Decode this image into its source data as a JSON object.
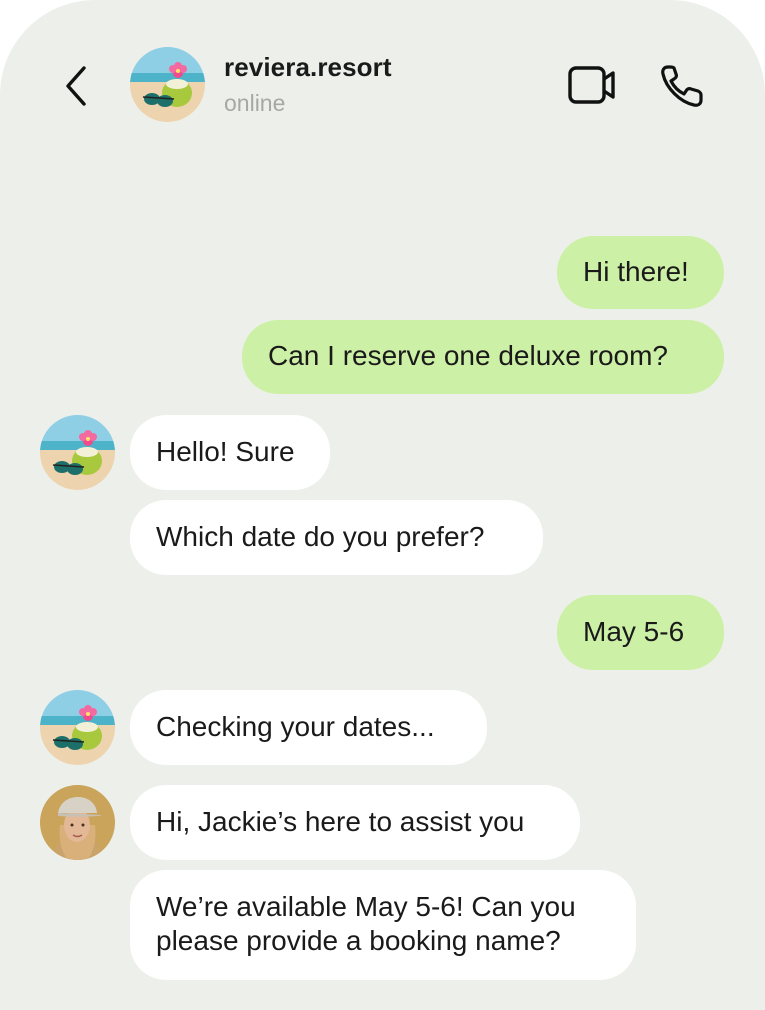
{
  "header": {
    "contact_name": "reviera.resort",
    "status": "online",
    "back_icon": "chevron-left-icon",
    "video_icon": "video-camera-icon",
    "call_icon": "phone-icon"
  },
  "colors": {
    "background": "#edf0ea",
    "outgoing_bubble": "#cdf0a7",
    "incoming_bubble": "#ffffff",
    "status_text": "#a6a8a4"
  },
  "messages": [
    {
      "direction": "out",
      "text": "Hi there!"
    },
    {
      "direction": "out",
      "text": "Can I reserve one deluxe room?"
    },
    {
      "direction": "in",
      "sender": "resort",
      "text": "Hello! Sure"
    },
    {
      "direction": "in",
      "sender": "resort",
      "text": "Which date do you prefer?"
    },
    {
      "direction": "out",
      "text": "May 5-6"
    },
    {
      "direction": "in",
      "sender": "resort",
      "text": "Checking your dates..."
    },
    {
      "direction": "in",
      "sender": "agent",
      "text": "Hi, Jackie’s here to assist you"
    },
    {
      "direction": "in",
      "sender": "agent",
      "lines": [
        "We’re available May 5-6! Can you",
        "please provide a booking name?"
      ]
    }
  ]
}
